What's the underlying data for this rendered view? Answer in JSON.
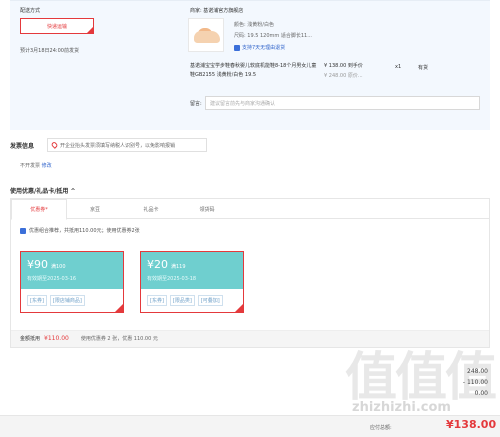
{
  "delivery": {
    "section_label": "配送方式",
    "express_label": "快递运输",
    "delivery_note": "预计3月18日24:00前发货"
  },
  "product": {
    "shop_name": "商家: 基诺浦官方旗舰店",
    "color": "颜色: 浅黄粉/白色",
    "size": "尺码: 19.5 120mm 适合脚长11...",
    "support": "支持7天无理由退货",
    "title": "基诺浦宝宝学步鞋春秋婴儿软底机能鞋8-18个月男女儿童鞋GB2155 浅黄粉/白色 19.5",
    "price": "¥ 138.00 到手价",
    "orig_price": "¥ 248.00 原价...",
    "qty": "x1",
    "stock": "有货"
  },
  "remark": {
    "label": "留言:",
    "placeholder": "建议留言前先与商家沟通确认"
  },
  "invoice": {
    "title": "发票信息",
    "tip": "开企业抬头发票须填写纳税人识别号，以免影响报销",
    "status": "不开发票",
    "edit": "修改"
  },
  "coupons": {
    "header": "使用优惠/礼品卡/抵用 ^",
    "tabs": [
      {
        "label": "优惠券",
        "badge": "*"
      },
      {
        "label": "京豆",
        "badge": ""
      },
      {
        "label": "礼品卡",
        "badge": ""
      },
      {
        "label": "领货码",
        "badge": ""
      }
    ],
    "optimal_line": "优惠组合推荐，共抵用110.00元；使用优惠券2张",
    "list": [
      {
        "amount": "¥90",
        "cond": "满100",
        "valid": "有效期至2025-03-16",
        "tags": [
          "[东券]",
          "[限店铺商品]"
        ]
      },
      {
        "amount": "¥20",
        "cond": "满119",
        "valid": "有效期至2025-03-18",
        "tags": [
          "[东券]",
          "[限品类]",
          "[可叠加]"
        ]
      }
    ],
    "summary_label": "金额抵用",
    "summary_amount": "¥110.00",
    "summary_note": "使用优惠券 2 张，优惠 110.00 元"
  },
  "totals": {
    "line1_value": "248.00",
    "line2_value": "- 110.00",
    "line3_value": "0.00"
  },
  "payment": {
    "label": "应付总额:",
    "amount": "¥138.00"
  },
  "watermark": {
    "big": "值值值",
    "small": "zhizhizhi.com"
  }
}
